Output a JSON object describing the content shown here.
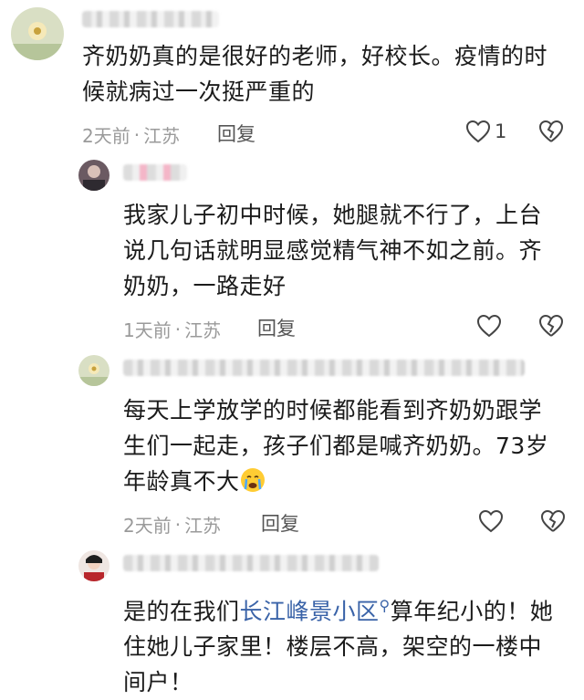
{
  "comments": [
    {
      "text": "齐奶奶真的是很好的老师，好校长。疫情的时\n候就病过一次挺严重的",
      "time": "2天前",
      "location": "江苏",
      "reply_label": "回复",
      "likes": "1"
    },
    {
      "text": "我家儿子初中时候，她腿就不行了，上台\n说几句话就明显感觉精气神不如之前。齐\n奶奶，一路走好",
      "time": "1天前",
      "location": "江苏",
      "reply_label": "回复",
      "likes": ""
    },
    {
      "text": "每天上学放学的时候都能看到齐奶奶跟学\n生们一起走，孩子们都是喊齐奶奶。73岁\n年龄真不大",
      "time": "2天前",
      "location": "江苏",
      "reply_label": "回复",
      "likes": ""
    },
    {
      "text_before_link": "是的在我们",
      "link_text": "长江峰景小区",
      "text_after_link": "算年纪小的！她\n住她儿子家里！楼层不高，架空的一楼中\n间户！"
    }
  ],
  "icons": {
    "like": "heart-outline-icon",
    "dislike": "broken-heart-icon",
    "emoji": "crying-face-emoji",
    "search": "search-icon"
  },
  "separator": "·"
}
